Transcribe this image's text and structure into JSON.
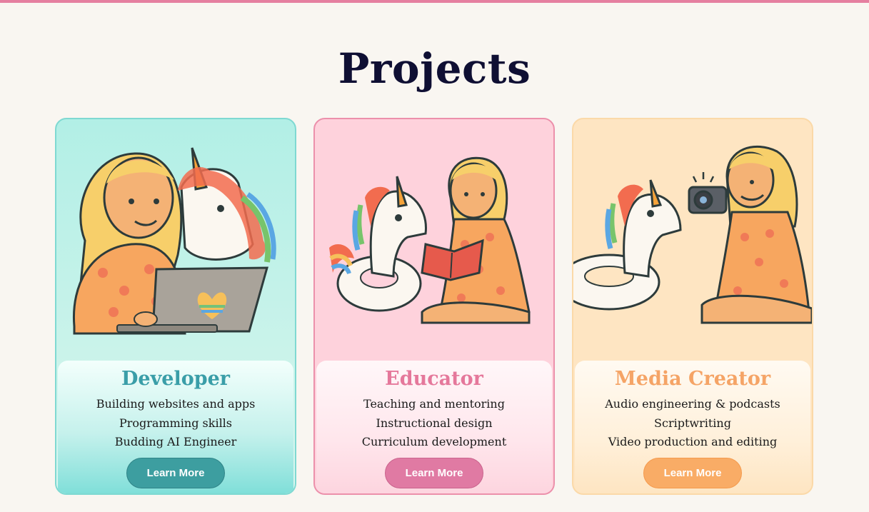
{
  "page": {
    "title": "Projects"
  },
  "colors": {
    "accent_bar": "#e57fa0",
    "title": "#0f0f33"
  },
  "cards": [
    {
      "title": "Developer",
      "illustration": "girl-with-laptop-and-unicorn",
      "items": [
        "Building websites and apps",
        "Programming skills",
        "Budding AI Engineer"
      ],
      "button": "Learn More"
    },
    {
      "title": "Educator",
      "illustration": "girl-reading-book-with-unicorn-float",
      "items": [
        "Teaching and mentoring",
        "Instructional design",
        "Curriculum development"
      ],
      "button": "Learn More"
    },
    {
      "title": "Media Creator",
      "illustration": "girl-with-camera-and-unicorn-float",
      "items": [
        "Audio engineering & podcasts",
        "Scriptwriting",
        "Video production and editing"
      ],
      "button": "Learn More"
    }
  ]
}
